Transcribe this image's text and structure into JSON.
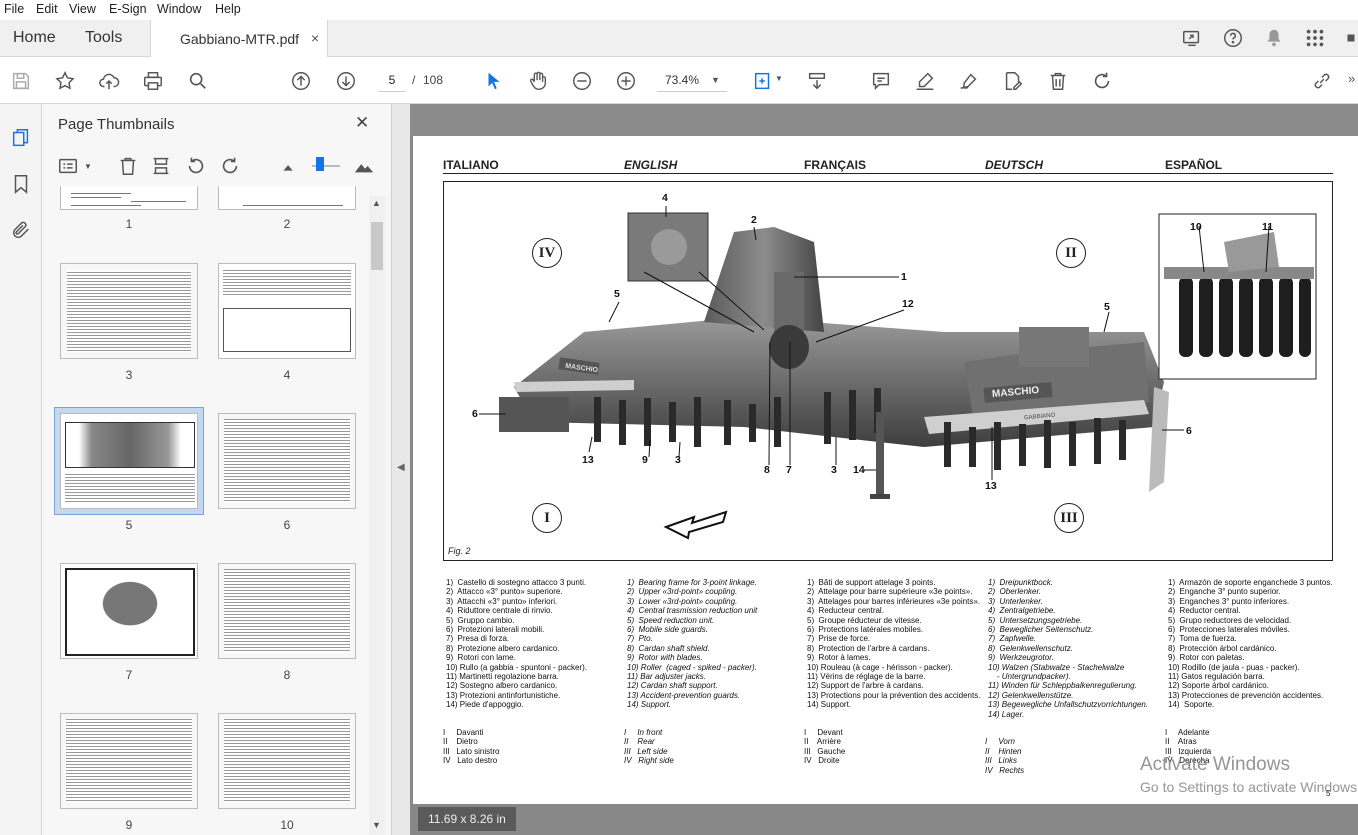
{
  "menu": [
    "File",
    "Edit",
    "View",
    "E-Sign",
    "Window",
    "Help"
  ],
  "tabs": {
    "home": "Home",
    "tools": "Tools",
    "doc": "Gabbiano-MTR.pdf",
    "close": "×"
  },
  "toolbar": {
    "page_current": "5",
    "page_sep": "/",
    "page_total": "108",
    "zoom": "73.4%"
  },
  "panel": {
    "title": "Page Thumbnails",
    "close": "✕",
    "thumbs": [
      "1",
      "2",
      "3",
      "4",
      "5",
      "6",
      "7",
      "8",
      "9",
      "10"
    ]
  },
  "document": {
    "headers": [
      "ITALIANO",
      "ENGLISH",
      "FRANÇAIS",
      "DEUTSCH",
      "ESPAÑOL"
    ],
    "figure_label": "Fig. 2",
    "brand": "MASCHIO",
    "model": "GABBIANO",
    "callouts": [
      "1",
      "2",
      "3",
      "3",
      "4",
      "5",
      "5",
      "6",
      "6",
      "7",
      "8",
      "9",
      "10",
      "11",
      "12",
      "13",
      "13",
      "14"
    ],
    "romans": [
      "I",
      "II",
      "III",
      "IV"
    ],
    "lists": {
      "it": "1)  Castello di sostegno attacco 3 punti.\n2)  Attacco «3° punto» superiore.\n3)  Attacchi «3° punto» inferiori.\n4)  Riduttore centrale di rinvio.\n5)  Gruppo cambio.\n6)  Protezioni laterali mobili.\n7)  Presa di forza.\n8)  Protezione albero cardanico.\n9)  Rotori con lame.\n10) Rullo (a gabbia - spuntoni - packer).\n11) Martinetti regolazione barra.\n12) Sostegno albero cardanico.\n13) Protezioni antinfortunistiche.\n14) Piede d'appoggio.",
      "en": "1)  Bearing frame for 3-point linkage.\n2)  Upper «3rd-point» coupling.\n3)  Lower «3rd-point» coupling.\n4)  Central trasmission reduction unit\n5)  Speed reduction unit.\n6)  Mobile side guards.\n7)  Pto.\n8)  Cardan shaft shield.\n9)  Rotor with blades.\n10) Roller  (caged - spiked - packer).\n11) Bar adjuster jacks.\n12) Cardan shaft support.\n13) Accident-prevention guards.\n14) Support.",
      "fr": "1)  Bâti de support attelage 3 points.\n2)  Attelage pour barre supérieure «3e points».\n3)  Attelages pour barres inférieures «3e points».\n4)  Reducteur central.\n5)  Groupe réducteur de vitesse.\n6)  Protections latérales mobiles.\n7)  Prise de force.\n8)  Protection de l'arbre à cardans.\n9)  Rotor à lames.\n10) Rouleau (à cage - hérisson - packer).\n11) Vérins de réglage de la barre.\n12) Support de l'arbre à cardans.\n13) Protections pour la prévention des accidents.\n14) Support.",
      "de": "1)  Dreipunktbock.\n2)  Oberlenker.\n3)  Unterlenker.\n4)  Zentralgetriebe.\n5)  Untersetzungsgetriebe.\n6)  Beweglicher Seitenschutz.\n7)  Zapfwelle.\n8)  Gelenkwellenschutz.\n9)  Werkzeugrotor.\n10) Walzen (Stabwalze - Stachelwalze\n    - Untergrundpacker).\n11) Winden für Schleppbalkenregulierung.\n12) Gelenkwellenstütze.\n13) Begewegliche Unfallschutzvorrichtungen.\n14) Lager.",
      "es": "1)  Armazón de soporte enganchede 3 puntos.\n2)  Enganche 3° punto superior.\n3)  Enganches 3° punto inferiores.\n4)  Reductor central.\n5)  Grupo reductores de velocidad.\n6)  Protecciones laterales móviles.\n7)  Toma de fuerza.\n8)  Protección árbol cardánico.\n9)  Rotor con paletas.\n10) Rodillo (de jaula - puas - packer).\n11) Gatos regulación barra.\n12) Soporte árbol cardánico.\n13) Protecciones de prevención accidentes.\n14)  Soporte."
    },
    "roman_lists": {
      "it": "I     Davanti\nII    Dietro\nIII   Lato sinistro\nIV   Lato destro",
      "en": "I     In front\nII    Rear\nIII   Left side\nIV   Right side",
      "fr": "I     Devant\nII    Arrière\nIII   Gauche\nIV   Droite",
      "de": "\nI     Vorn\nII    Hinten\nIII   Links\nIV   Rechts",
      "es": "I     Adelante\nII    Atras\nIII   Izquierda\nIV   Derecha"
    },
    "page_number": "5"
  },
  "status": {
    "size": "11.69 x 8.26 in"
  },
  "watermark": {
    "line1": "Activate Windows",
    "line2": "Go to Settings to activate Windows."
  }
}
